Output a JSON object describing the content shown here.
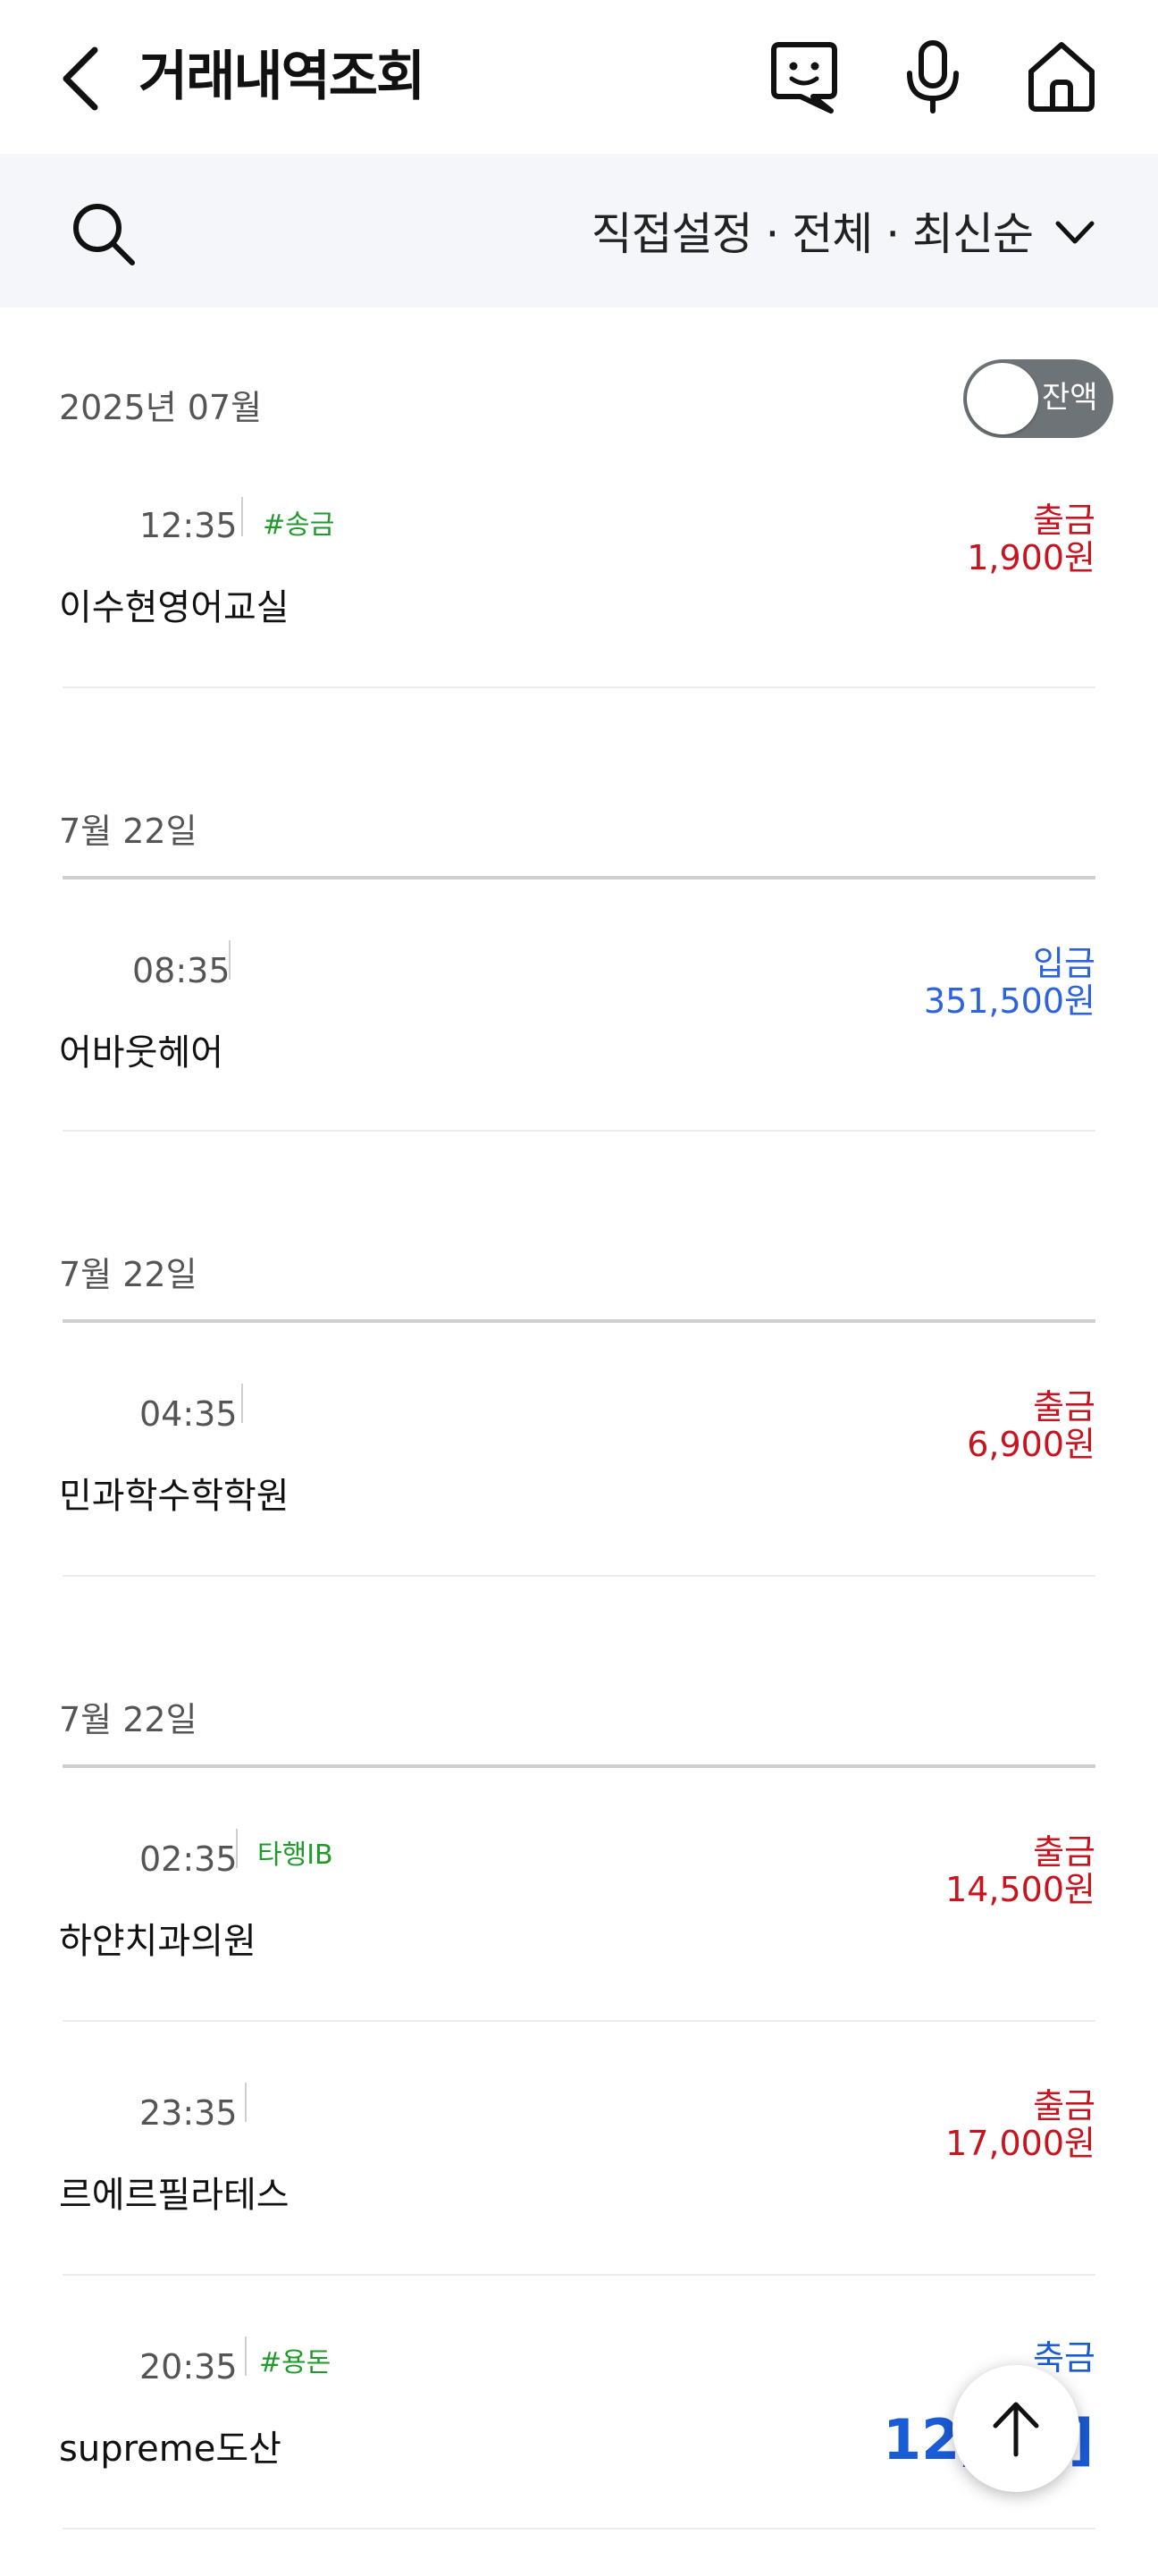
{
  "header": {
    "title": "거래내역조회",
    "icons": [
      "back-icon",
      "chat-bot-icon",
      "microphone-icon",
      "home-icon"
    ]
  },
  "filter": {
    "label": "직접설정 · 전체 · 최신순",
    "icons": [
      "search-icon",
      "chevron-down-icon"
    ]
  },
  "month_label": "2025년 07월",
  "balance_toggle": {
    "label": "잔액",
    "on": false
  },
  "transactions": [
    {
      "time": "12:35",
      "tag": "#송금",
      "type": "출금",
      "amount": "1,900원",
      "merchant": "이수현영어교실"
    },
    {
      "date": "7월 22일",
      "time": "08:35",
      "tag": "",
      "type": "입금",
      "amount": "351,500원",
      "merchant": "어바웃헤어"
    },
    {
      "date": "7월 22일",
      "time": "04:35",
      "tag": "",
      "type": "출금",
      "amount": "6,900원",
      "merchant": "민과학수학학원"
    },
    {
      "date": "7월 22일",
      "time": "02:35",
      "tag": "타행IB",
      "type": "출금",
      "amount": "14,500원",
      "merchant": "하얀치과의원"
    },
    {
      "time": "23:35",
      "tag": "",
      "type": "출금",
      "amount": "17,000원",
      "merchant": "르에르필라테스"
    },
    {
      "time": "20:35",
      "tag": "#용돈",
      "type": "축금",
      "amount": "12,",
      "amount_tail": "]",
      "merchant": "supreme도산"
    }
  ],
  "colors": {
    "withdraw": "#c8141e",
    "deposit": "#2e63e0",
    "tag": "#1f9a2b",
    "filter_bg": "#f4f6f9"
  },
  "fab": {
    "icon": "arrow-up-icon"
  }
}
